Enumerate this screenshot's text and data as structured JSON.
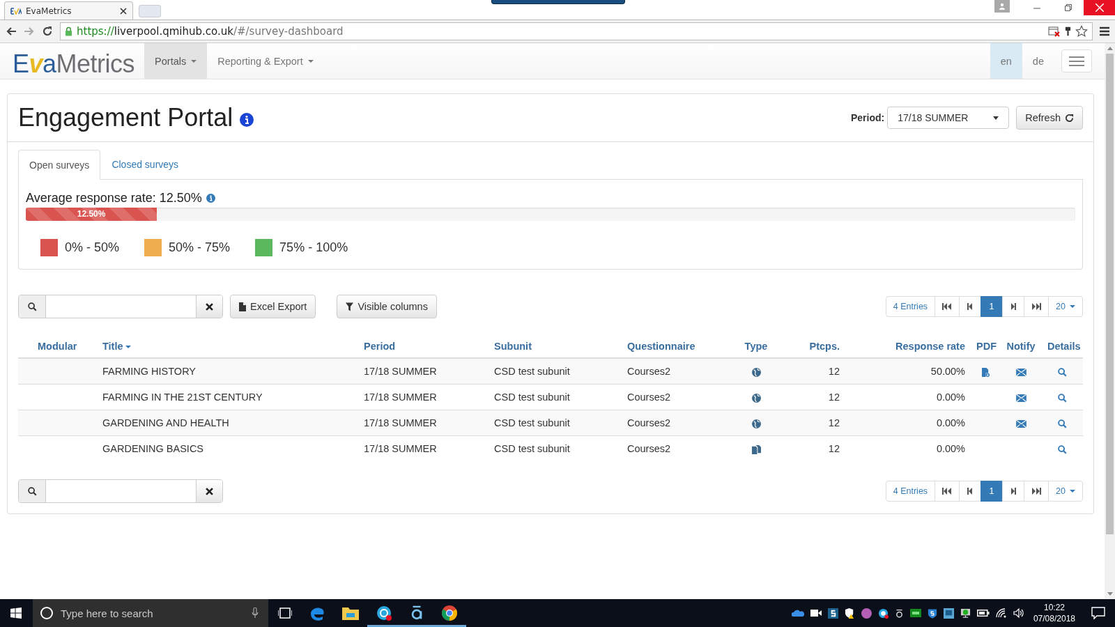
{
  "browser": {
    "tab_title": "EvaMetrics",
    "address": {
      "scheme": "https://",
      "host": "liverpool.qmihub.co.uk",
      "path": "/#/survey-dashboard"
    }
  },
  "navbar": {
    "logo": {
      "first": "E",
      "mark": "v",
      "rest": "aMetrics"
    },
    "items": [
      {
        "label": "Portals",
        "selected": true
      },
      {
        "label": "Reporting & Export",
        "selected": false
      }
    ],
    "languages": [
      {
        "label": "en",
        "selected": true
      },
      {
        "label": "de",
        "selected": false
      }
    ]
  },
  "portal": {
    "title": "Engagement Portal",
    "period_label": "Period:",
    "period_value": "17/18 SUMMER",
    "refresh": "Refresh"
  },
  "tabs": [
    {
      "label": "Open surveys",
      "selected": true
    },
    {
      "label": "Closed surveys",
      "selected": false
    }
  ],
  "summary": {
    "label": "Average response rate: 12.50%",
    "level": 0.125,
    "bar_label": "12.50%"
  },
  "legend": [
    {
      "label": "0% - 50%",
      "color": "#d9534f"
    },
    {
      "label": "50% - 75%",
      "color": "#f0ad4e"
    },
    {
      "label": "75% - 100%",
      "color": "#5cb85c"
    }
  ],
  "toolbar": {
    "excel": "Excel Export",
    "columns": "Visible columns"
  },
  "pager": {
    "entries": "4 Entries",
    "page": "1",
    "page_size": "20"
  },
  "table": {
    "columns": [
      {
        "label": "Modular"
      },
      {
        "label": "Title",
        "sorted": true
      },
      {
        "label": "Period"
      },
      {
        "label": "Subunit"
      },
      {
        "label": "Questionnaire"
      },
      {
        "label": "Type"
      },
      {
        "label": "Ptcps."
      },
      {
        "label": "Response rate"
      },
      {
        "label": "PDF"
      },
      {
        "label": "Notify"
      },
      {
        "label": "Details"
      }
    ],
    "rows": [
      {
        "title": "FARMING HISTORY",
        "period": "17/18 SUMMER",
        "subunit": "CSD test subunit",
        "questionnaire": "Courses2",
        "kind": "web",
        "participants": "12",
        "response_rate": "50.00%",
        "pdf": true,
        "notify": true
      },
      {
        "title": "FARMING IN THE 21ST CENTURY",
        "period": "17/18 SUMMER",
        "subunit": "CSD test subunit",
        "questionnaire": "Courses2",
        "kind": "web",
        "participants": "12",
        "response_rate": "0.00%",
        "pdf": false,
        "notify": true
      },
      {
        "title": "GARDENING AND HEALTH",
        "period": "17/18 SUMMER",
        "subunit": "CSD test subunit",
        "questionnaire": "Courses2",
        "kind": "web",
        "participants": "12",
        "response_rate": "0.00%",
        "pdf": false,
        "notify": true
      },
      {
        "title": "GARDENING BASICS",
        "period": "17/18 SUMMER",
        "subunit": "CSD test subunit",
        "questionnaire": "Courses2",
        "kind": "paper",
        "participants": "12",
        "response_rate": "0.00%",
        "pdf": false,
        "notify": false
      }
    ]
  },
  "bottom_pager": {
    "entries": "4 Entries",
    "page": "1",
    "page_size": "20"
  },
  "taskbar": {
    "search_placeholder": "Type here to search",
    "time": "10:22",
    "date": "07/08/2018"
  }
}
